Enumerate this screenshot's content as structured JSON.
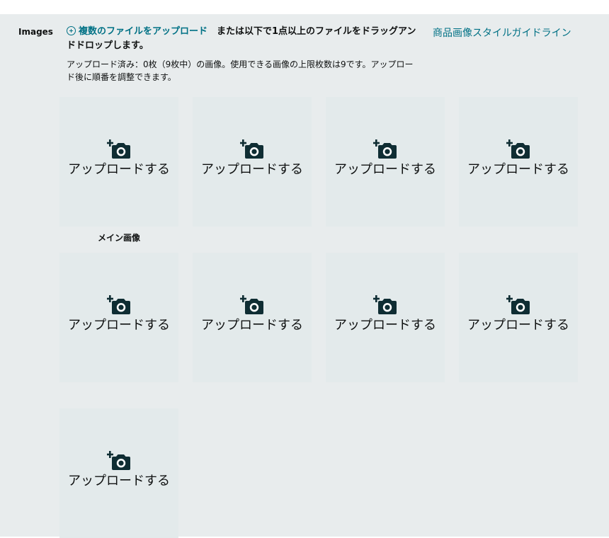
{
  "section": {
    "label": "Images"
  },
  "upload": {
    "link_label": "複数のファイルをアップロード",
    "drag_text": "　または以下で1点以上のファイルをドラッグアンドドロップします。",
    "guide_link": "商品画像スタイルガイドライン",
    "status": "アップロード済み：0枚（9枚中）の画像。使用できる画像の上限枚数は9です。アップロード後に順番を調整できます。"
  },
  "slots": [
    {
      "label": "アップロードする",
      "icon": "add-photo-camera-icon"
    },
    {
      "label": "アップロードする",
      "icon": "add-photo-camera-icon"
    },
    {
      "label": "アップロードする",
      "icon": "add-photo-camera-icon"
    },
    {
      "label": "アップロードする",
      "icon": "add-photo-camera-icon"
    },
    {
      "label": "アップロードする",
      "icon": "add-photo-camera-icon"
    },
    {
      "label": "アップロードする",
      "icon": "add-photo-camera-icon"
    },
    {
      "label": "アップロードする",
      "icon": "add-photo-camera-icon"
    },
    {
      "label": "アップロードする",
      "icon": "add-photo-camera-icon"
    },
    {
      "label": "アップロードする",
      "icon": "add-photo-camera-icon"
    }
  ],
  "main_image_caption": "メイン画像",
  "colors": {
    "accent": "#007185",
    "panel": "#e8eced",
    "slot": "#e3eaeb",
    "icon": "#0f2d33"
  }
}
